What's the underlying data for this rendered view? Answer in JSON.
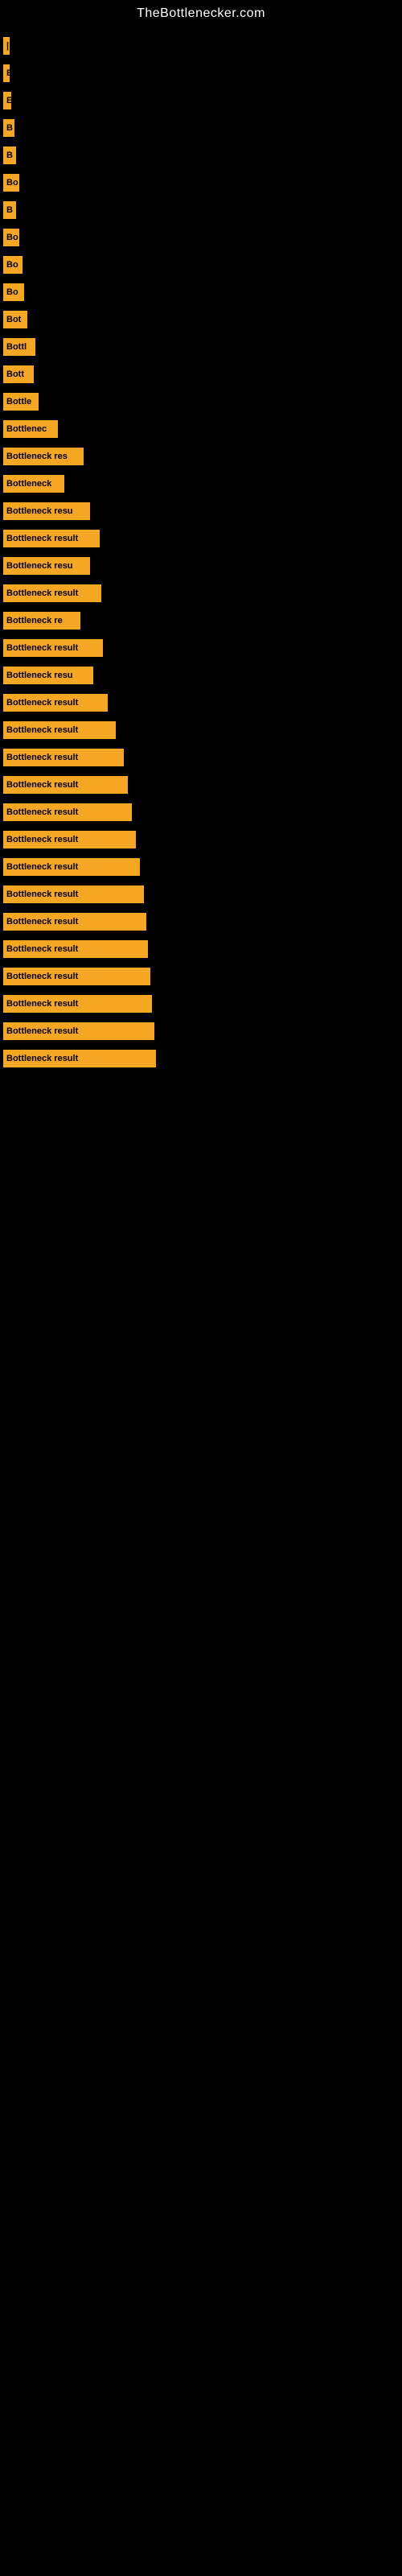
{
  "site": {
    "title": "TheBottlenecker.com"
  },
  "bars": [
    {
      "label": "|",
      "width": 4
    },
    {
      "label": "E",
      "width": 8
    },
    {
      "label": "E",
      "width": 10
    },
    {
      "label": "B",
      "width": 14
    },
    {
      "label": "B",
      "width": 16
    },
    {
      "label": "Bo",
      "width": 20
    },
    {
      "label": "B",
      "width": 16
    },
    {
      "label": "Bo",
      "width": 20
    },
    {
      "label": "Bo",
      "width": 24
    },
    {
      "label": "Bo",
      "width": 26
    },
    {
      "label": "Bot",
      "width": 30
    },
    {
      "label": "Bottl",
      "width": 40
    },
    {
      "label": "Bott",
      "width": 38
    },
    {
      "label": "Bottle",
      "width": 44
    },
    {
      "label": "Bottlenec",
      "width": 68
    },
    {
      "label": "Bottleneck res",
      "width": 100
    },
    {
      "label": "Bottleneck",
      "width": 76
    },
    {
      "label": "Bottleneck resu",
      "width": 108
    },
    {
      "label": "Bottleneck result",
      "width": 120
    },
    {
      "label": "Bottleneck resu",
      "width": 108
    },
    {
      "label": "Bottleneck result",
      "width": 122
    },
    {
      "label": "Bottleneck re",
      "width": 96
    },
    {
      "label": "Bottleneck result",
      "width": 124
    },
    {
      "label": "Bottleneck resu",
      "width": 112
    },
    {
      "label": "Bottleneck result",
      "width": 130
    },
    {
      "label": "Bottleneck result",
      "width": 140
    },
    {
      "label": "Bottleneck result",
      "width": 150
    },
    {
      "label": "Bottleneck result",
      "width": 155
    },
    {
      "label": "Bottleneck result",
      "width": 160
    },
    {
      "label": "Bottleneck result",
      "width": 165
    },
    {
      "label": "Bottleneck result",
      "width": 170
    },
    {
      "label": "Bottleneck result",
      "width": 175
    },
    {
      "label": "Bottleneck result",
      "width": 178
    },
    {
      "label": "Bottleneck result",
      "width": 180
    },
    {
      "label": "Bottleneck result",
      "width": 183
    },
    {
      "label": "Bottleneck result",
      "width": 185
    },
    {
      "label": "Bottleneck result",
      "width": 188
    },
    {
      "label": "Bottleneck result",
      "width": 190
    }
  ]
}
